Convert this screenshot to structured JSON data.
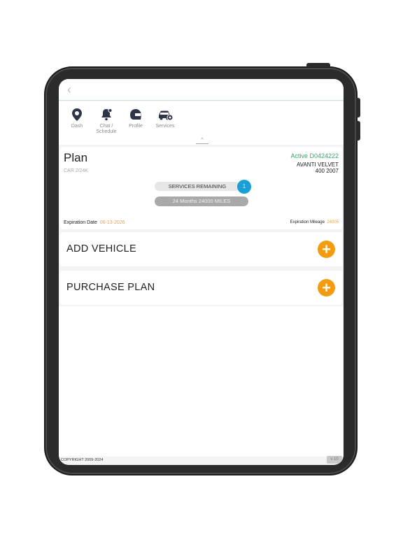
{
  "nav": {
    "back": "‹",
    "items": [
      {
        "label": "Dash",
        "icon": "location-pin-icon"
      },
      {
        "label": "Chat /\nSchedule",
        "icon": "chat-schedule-icon"
      },
      {
        "label": "Profile",
        "icon": "helmet-icon"
      },
      {
        "label": "Services",
        "icon": "car-service-icon"
      }
    ],
    "caret": "^"
  },
  "plan": {
    "title": "Plan",
    "subtitle": "CAR 2/24K",
    "status": "Active D0424222",
    "vehicle_line1": "AVANTI VELVET",
    "vehicle_line2": "400 2007",
    "services_remaining_label": "SERVICES REMAINING",
    "services_remaining_count": "1",
    "term": "24 Months 24000 MILES",
    "expiration_date_label": "Expiration Date",
    "expiration_date": "06-13-2026",
    "expiration_mileage_label": "Expiration Mileage",
    "expiration_mileage": "24005"
  },
  "actions": {
    "add_vehicle": "ADD VEHICLE",
    "purchase_plan": "PURCHASE PLAN",
    "plus": "+"
  },
  "footer": {
    "copyright": "COPYRIGHT 2009-2024",
    "version": "v 10"
  },
  "colors": {
    "accent_orange": "#f39c12",
    "active_green": "#3aa56a",
    "badge_blue": "#1ba0d6",
    "icon_dark": "#2f3447"
  }
}
